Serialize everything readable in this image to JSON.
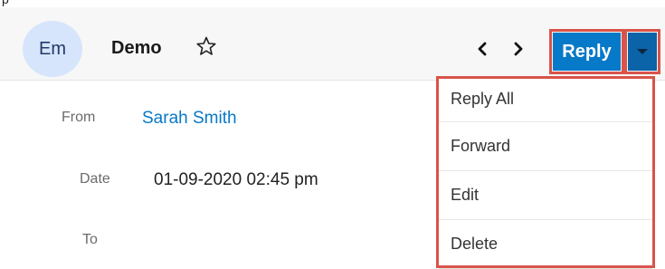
{
  "top_fragment": "p",
  "record": {
    "avatar_text": "Em",
    "name": "Demo"
  },
  "actions": {
    "reply_label": "Reply"
  },
  "fields": [
    {
      "label": "From",
      "value": "Sarah Smith"
    },
    {
      "label": "Date",
      "value": "01-09-2020 02:45 pm"
    },
    {
      "label": "To",
      "value": ""
    }
  ],
  "dropdown": {
    "items": [
      {
        "label": "Reply All"
      },
      {
        "label": "Forward"
      },
      {
        "label": "Edit"
      },
      {
        "label": "Delete"
      }
    ]
  },
  "colors": {
    "primary": "#0679c8",
    "highlight_border": "#d9544a",
    "avatar_bg": "#d6e5fb"
  },
  "icons": [
    "star-icon",
    "chevron-left-icon",
    "chevron-right-icon",
    "caret-down-icon"
  ]
}
